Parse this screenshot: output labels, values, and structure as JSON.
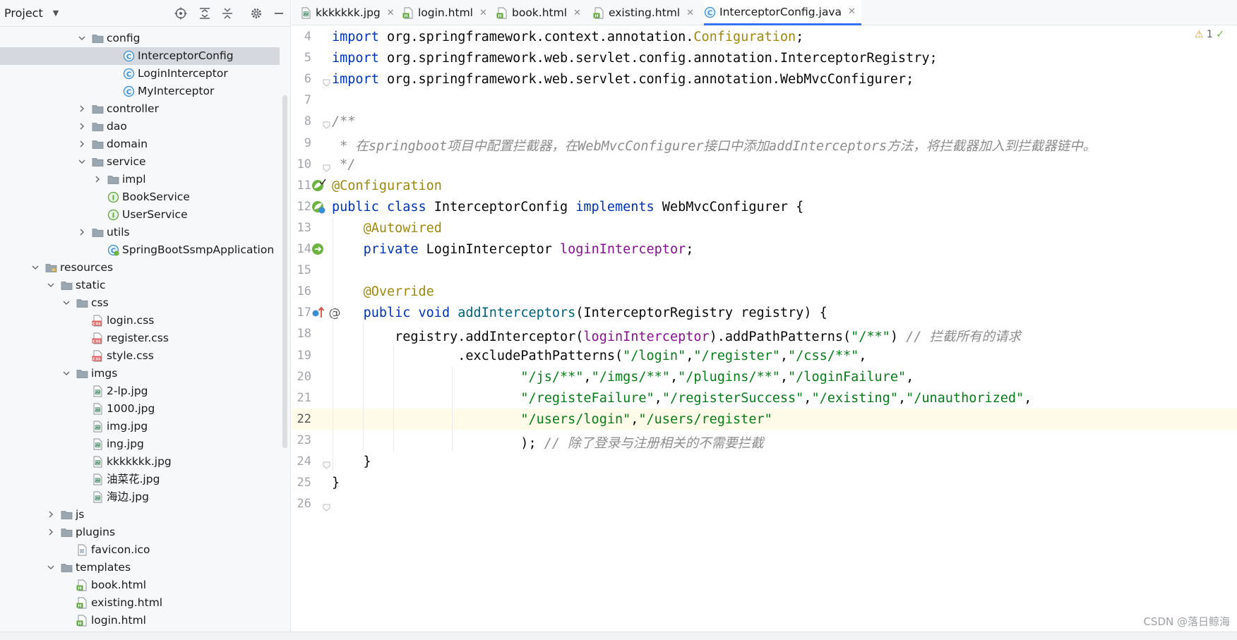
{
  "project_panel": {
    "title": "Project",
    "tree": [
      {
        "label": "config",
        "type": "folder",
        "expanded": true
      },
      {
        "label": "InterceptorConfig",
        "type": "class",
        "selected": true
      },
      {
        "label": "LoginInterceptor",
        "type": "class"
      },
      {
        "label": "MyInterceptor",
        "type": "class"
      },
      {
        "label": "controller",
        "type": "folder",
        "expanded": false
      },
      {
        "label": "dao",
        "type": "folder",
        "expanded": false
      },
      {
        "label": "domain",
        "type": "folder",
        "expanded": false
      },
      {
        "label": "service",
        "type": "folder",
        "expanded": true
      },
      {
        "label": "impl",
        "type": "folder",
        "expanded": false
      },
      {
        "label": "BookService",
        "type": "interface"
      },
      {
        "label": "UserService",
        "type": "interface"
      },
      {
        "label": "utils",
        "type": "folder",
        "expanded": false
      },
      {
        "label": "SpringBootSsmpApplication",
        "type": "springboot"
      },
      {
        "label": "resources",
        "type": "resources-folder",
        "expanded": true
      },
      {
        "label": "static",
        "type": "folder",
        "expanded": true
      },
      {
        "label": "css",
        "type": "folder",
        "expanded": true
      },
      {
        "label": "login.css",
        "type": "css-file"
      },
      {
        "label": "register.css",
        "type": "css-file"
      },
      {
        "label": "style.css",
        "type": "css-file"
      },
      {
        "label": "imgs",
        "type": "folder",
        "expanded": true
      },
      {
        "label": "2-lp.jpg",
        "type": "image-file"
      },
      {
        "label": "1000.jpg",
        "type": "image-file"
      },
      {
        "label": "img.jpg",
        "type": "image-file"
      },
      {
        "label": "ing.jpg",
        "type": "image-file"
      },
      {
        "label": "kkkkkkk.jpg",
        "type": "image-file"
      },
      {
        "label": "油菜花.jpg",
        "type": "image-file"
      },
      {
        "label": "海边.jpg",
        "type": "image-file"
      },
      {
        "label": "js",
        "type": "folder",
        "expanded": false
      },
      {
        "label": "plugins",
        "type": "folder",
        "expanded": false
      },
      {
        "label": "favicon.ico",
        "type": "ico-file"
      },
      {
        "label": "templates",
        "type": "folder",
        "expanded": true
      },
      {
        "label": "book.html",
        "type": "html-file"
      },
      {
        "label": "existing.html",
        "type": "html-file"
      },
      {
        "label": "login.html",
        "type": "html-file"
      }
    ]
  },
  "tabs": [
    {
      "label": "kkkkkkk.jpg",
      "type": "image-file"
    },
    {
      "label": "login.html",
      "type": "html-file"
    },
    {
      "label": "book.html",
      "type": "html-file"
    },
    {
      "label": "existing.html",
      "type": "html-file"
    },
    {
      "label": "InterceptorConfig.java",
      "type": "class",
      "active": true
    }
  ],
  "editor": {
    "warning_count": "1",
    "current_line": 22,
    "lines": [
      {
        "n": "4",
        "tokens": [
          {
            "t": "import",
            "c": "kw"
          },
          {
            "t": " org.springframework.context.annotation."
          },
          {
            "t": "Configuration",
            "c": "ann"
          },
          {
            "t": ";"
          }
        ]
      },
      {
        "n": "5",
        "tokens": [
          {
            "t": "import",
            "c": "kw"
          },
          {
            "t": " org.springframework.web.servlet.config.annotation.InterceptorRegistry;"
          }
        ]
      },
      {
        "n": "6",
        "tokens": [
          {
            "t": "import",
            "c": "kw"
          },
          {
            "t": " org.springframework.web.servlet.config.annotation.WebMvcConfigurer;"
          }
        ]
      },
      {
        "n": "7",
        "tokens": []
      },
      {
        "n": "8",
        "tokens": [
          {
            "t": "/**",
            "c": "cmt"
          }
        ]
      },
      {
        "n": "9",
        "tokens": [
          {
            "t": " * 在springboot项目中配置拦截器，在WebMvcConfigurer接口中添加addInterceptors方法，将拦截器加入到拦截器链中。",
            "c": "cmt"
          }
        ]
      },
      {
        "n": "10",
        "tokens": [
          {
            "t": " */",
            "c": "cmt"
          }
        ]
      },
      {
        "n": "11",
        "tokens": [
          {
            "t": "@Configuration",
            "c": "ann"
          }
        ]
      },
      {
        "n": "12",
        "tokens": [
          {
            "t": "public class",
            "c": "kw"
          },
          {
            "t": " InterceptorConfig "
          },
          {
            "t": "implements",
            "c": "kw"
          },
          {
            "t": " WebMvcConfigurer {"
          }
        ]
      },
      {
        "n": "13",
        "tokens": [
          {
            "t": "    "
          },
          {
            "t": "@Autowired",
            "c": "ann"
          }
        ]
      },
      {
        "n": "14",
        "tokens": [
          {
            "t": "    "
          },
          {
            "t": "private",
            "c": "kw"
          },
          {
            "t": " LoginInterceptor "
          },
          {
            "t": "loginInterceptor",
            "c": "field"
          },
          {
            "t": ";"
          }
        ]
      },
      {
        "n": "15",
        "tokens": []
      },
      {
        "n": "16",
        "tokens": [
          {
            "t": "    "
          },
          {
            "t": "@Override",
            "c": "ann"
          }
        ]
      },
      {
        "n": "17",
        "tokens": [
          {
            "t": "    "
          },
          {
            "t": "public void",
            "c": "kw"
          },
          {
            "t": " "
          },
          {
            "t": "addInterceptors",
            "c": "meth"
          },
          {
            "t": "(InterceptorRegistry registry) {"
          }
        ]
      },
      {
        "n": "18",
        "tokens": [
          {
            "t": "        registry.addInterceptor("
          },
          {
            "t": "loginInterceptor",
            "c": "field"
          },
          {
            "t": ").addPathPatterns("
          },
          {
            "t": "\"/**\"",
            "c": "str"
          },
          {
            "t": ") "
          },
          {
            "t": "// 拦截所有的请求",
            "c": "cmt-line"
          }
        ]
      },
      {
        "n": "19",
        "tokens": [
          {
            "t": "                .excludePathPatterns("
          },
          {
            "t": "\"/login\"",
            "c": "str"
          },
          {
            "t": ","
          },
          {
            "t": "\"/register\"",
            "c": "str"
          },
          {
            "t": ","
          },
          {
            "t": "\"/css/**\"",
            "c": "str"
          },
          {
            "t": ","
          }
        ]
      },
      {
        "n": "20",
        "tokens": [
          {
            "t": "                        "
          },
          {
            "t": "\"/js/**\"",
            "c": "str"
          },
          {
            "t": ","
          },
          {
            "t": "\"/imgs/**\"",
            "c": "str"
          },
          {
            "t": ","
          },
          {
            "t": "\"/plugins/**\"",
            "c": "str"
          },
          {
            "t": ","
          },
          {
            "t": "\"/loginFailure\"",
            "c": "str"
          },
          {
            "t": ","
          }
        ]
      },
      {
        "n": "21",
        "tokens": [
          {
            "t": "                        "
          },
          {
            "t": "\"/registeFailure\"",
            "c": "str"
          },
          {
            "t": ","
          },
          {
            "t": "\"/registerSuccess\"",
            "c": "str"
          },
          {
            "t": ","
          },
          {
            "t": "\"/existing\"",
            "c": "str"
          },
          {
            "t": ","
          },
          {
            "t": "\"/unauthorized\"",
            "c": "str"
          },
          {
            "t": ","
          }
        ]
      },
      {
        "n": "22",
        "tokens": [
          {
            "t": "                        "
          },
          {
            "t": "\"/users/login\"",
            "c": "str"
          },
          {
            "t": ","
          },
          {
            "t": "\"/users/register\"",
            "c": "str"
          }
        ]
      },
      {
        "n": "23",
        "tokens": [
          {
            "t": "                        ); "
          },
          {
            "t": "// 除了登录与注册相关的不需要拦截",
            "c": "cmt-line"
          }
        ]
      },
      {
        "n": "24",
        "tokens": [
          {
            "t": "    }"
          }
        ]
      },
      {
        "n": "25",
        "tokens": [
          {
            "t": "}"
          }
        ]
      },
      {
        "n": "26",
        "tokens": []
      }
    ]
  },
  "watermark": "CSDN @落日鲸海",
  "colors": {
    "keyword": "#0033b3",
    "annotation": "#9e880d",
    "string": "#067d17",
    "field": "#871094",
    "method": "#00627a",
    "comment": "#8c8c8c",
    "selection": "#d5d9df",
    "current_line": "#fefbe9",
    "active_tab_accent": "#3574f0"
  }
}
